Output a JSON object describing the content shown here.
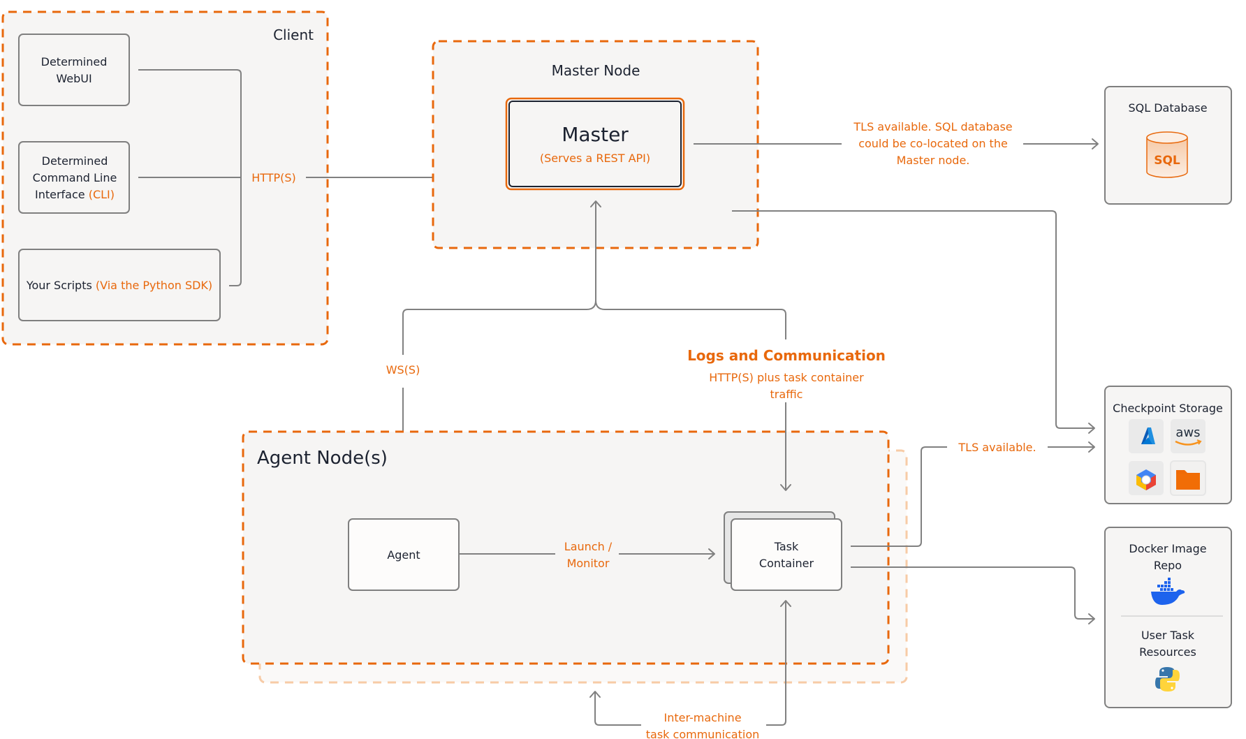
{
  "colors": {
    "accent_orange": "#e8680c",
    "light_orange": "#f7cba6",
    "connector_gray": "#808080",
    "panel_fill": "#f6f5f4",
    "text_dark": "#1c2230"
  },
  "client": {
    "title": "Client",
    "webui": {
      "line1": "Determined",
      "line2": "WebUI"
    },
    "cli": {
      "line1": "Determined",
      "line2": "Command Line",
      "line3_prefix": "Interface ",
      "line3_accent": "(CLI)"
    },
    "scripts": {
      "prefix": "Your Scripts ",
      "accent": "(Via the Python SDK)"
    },
    "protocol_label": "HTTP(S)"
  },
  "master_node": {
    "title": "Master Node",
    "master": {
      "title": "Master",
      "subtitle": "(Serves a REST API)"
    }
  },
  "sql_link": {
    "label_lines": [
      "TLS available. SQL database",
      "could be co-located on the",
      "Master node."
    ]
  },
  "sql_database": {
    "title": "SQL Database",
    "icon": "database-cylinder-icon",
    "icon_label": "SQL"
  },
  "ws_link": {
    "label": "WS(S)"
  },
  "logs_link": {
    "title": "Logs and Communication",
    "subtitle_lines": [
      "HTTP(S) plus task container",
      "traffic"
    ]
  },
  "agent_node": {
    "title": "Agent Node(s)",
    "agent": {
      "label": "Agent"
    },
    "launch_label_lines": [
      "Launch /",
      "Monitor"
    ],
    "task_container": {
      "line1": "Task",
      "line2": "Container"
    }
  },
  "inter_machine": {
    "label_lines": [
      "Inter-machine",
      "task communication"
    ]
  },
  "checkpoint_link": {
    "label": "TLS available."
  },
  "checkpoint_storage": {
    "title": "Checkpoint Storage",
    "providers": [
      {
        "name": "Azure",
        "icon": "azure-icon"
      },
      {
        "name": "AWS",
        "icon": "aws-icon",
        "text": "aws"
      },
      {
        "name": "Google Cloud",
        "icon": "gcp-icon"
      },
      {
        "name": "Shared FS",
        "icon": "folder-icon"
      }
    ]
  },
  "docker_repo": {
    "title_lines": [
      "Docker Image",
      "Repo"
    ],
    "icon": "docker-icon"
  },
  "user_task_resources": {
    "title_lines": [
      "User Task",
      "Resources"
    ],
    "icon": "python-icon"
  }
}
